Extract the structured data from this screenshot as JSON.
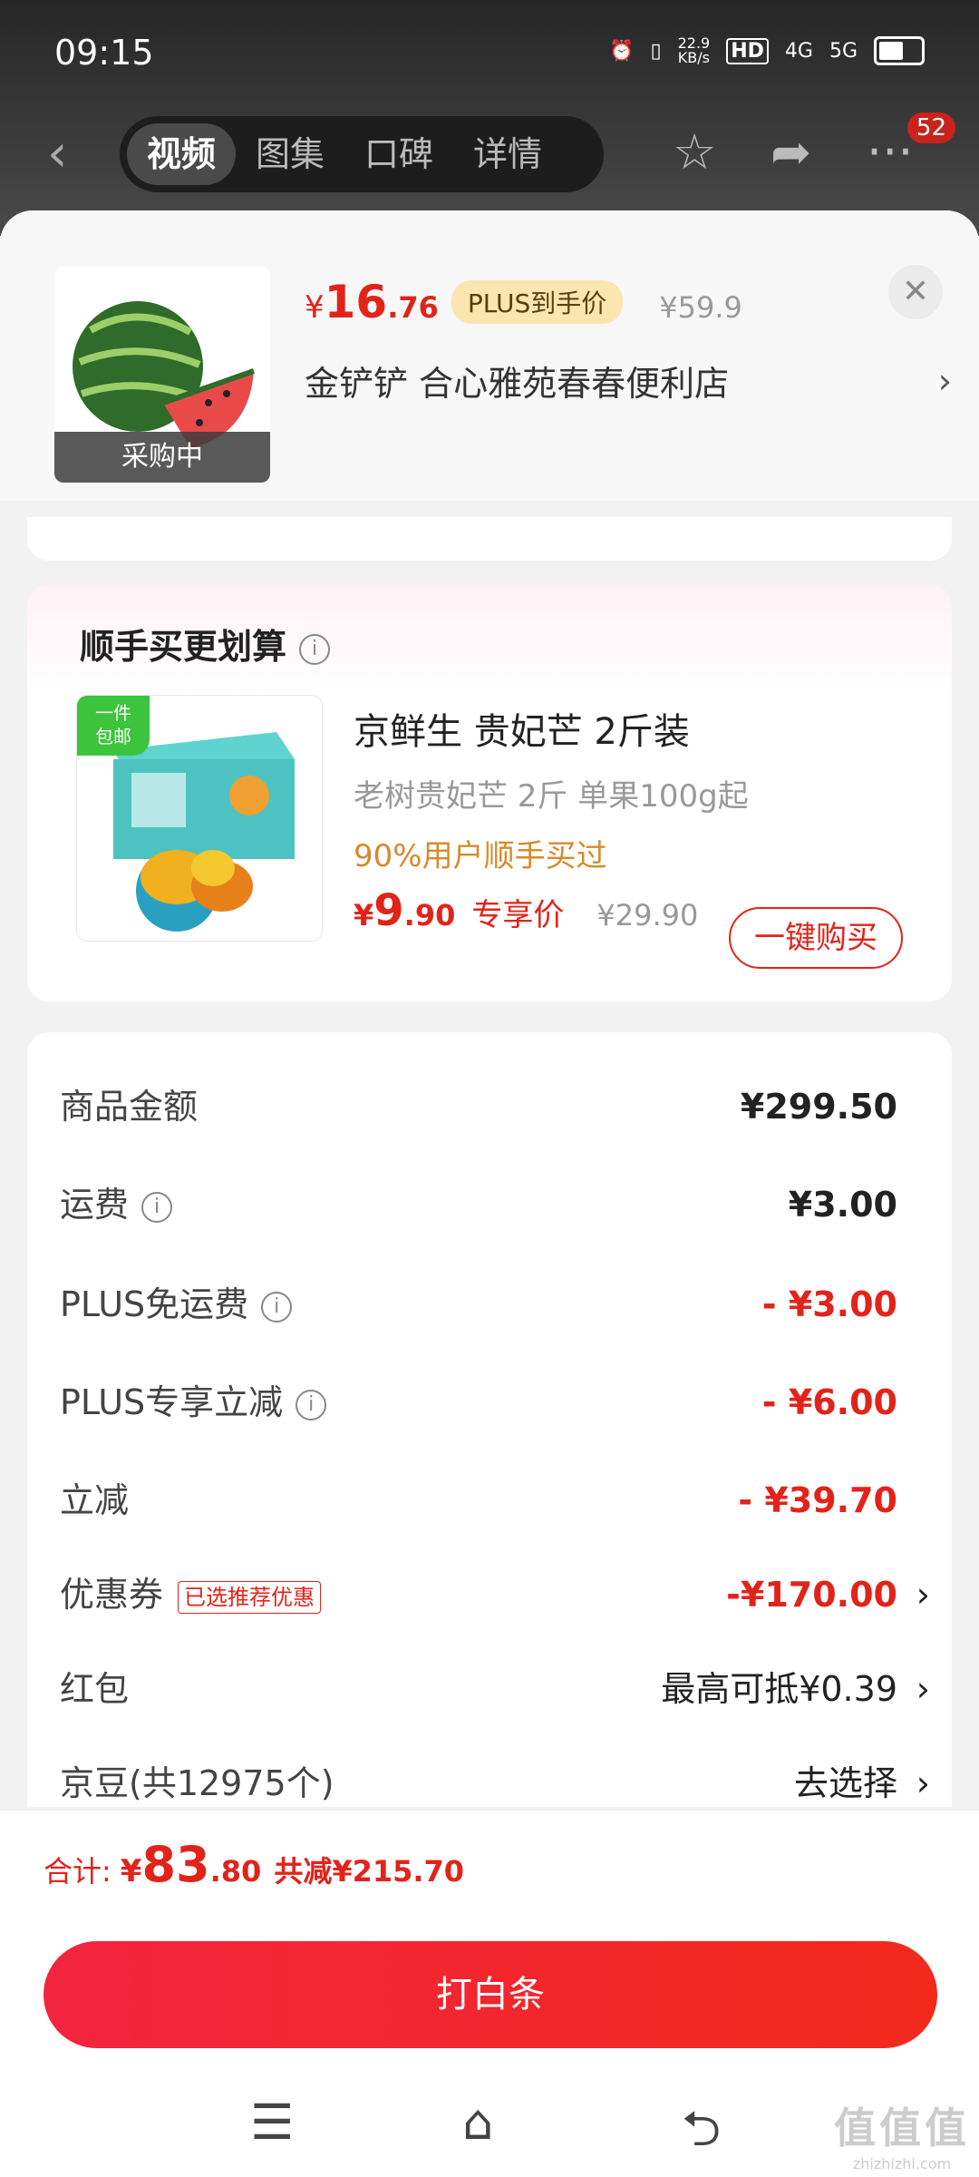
{
  "status_bar": {
    "time": "09:15",
    "speed_value": "22.9",
    "speed_unit": "KB/s",
    "hd": "HD",
    "net1": "4G",
    "net2": "5G"
  },
  "nav": {
    "tabs": [
      "视频",
      "图集",
      "口碑",
      "详情"
    ],
    "active_tab": "视频",
    "message_count": "52",
    "icons": [
      "back-icon",
      "star-icon",
      "share-icon",
      "more-icon"
    ]
  },
  "product": {
    "price_symbol": "¥",
    "price_int": "16",
    "price_dec": ".76",
    "plus_tag": "PLUS到手价",
    "original_price": "¥59.9",
    "store": "金铲铲  合心雅苑春春便利店",
    "thumb_label": "采购中"
  },
  "addon": {
    "title": "顺手买更划算",
    "free_tag_line1": "一件",
    "free_tag_line2": "包邮",
    "name": "京鲜生 贵妃芒 2斤装",
    "sub": "老树贵妃芒  2斤 单果100g起",
    "hint": "90%用户顺手买过",
    "price_symbol": "¥",
    "price_int": "9",
    "price_dec": ".90",
    "exclusive": "专享价",
    "original_price": "¥29.90",
    "buy_label": "一键购买"
  },
  "summary": {
    "rows": [
      {
        "label": "商品金额",
        "value": "¥299.50"
      },
      {
        "label": "运费",
        "value": "¥3.00"
      },
      {
        "label": "PLUS免运费",
        "value": "- ¥3.00"
      },
      {
        "label": "PLUS专享立减",
        "value": "- ¥6.00"
      },
      {
        "label": "立减",
        "value": "- ¥39.70"
      },
      {
        "label": "优惠券",
        "tag": "已选推荐优惠",
        "value": "-¥170.00"
      },
      {
        "label": "红包",
        "value": "最高可抵¥0.39"
      },
      {
        "label": "京豆(共12975个)",
        "value": "去选择"
      }
    ]
  },
  "footer": {
    "total_label": "合计:",
    "total_symbol": "¥",
    "total_int": "83",
    "total_dec": ".80",
    "saved": "共减¥215.70",
    "pay_label": "打白条"
  },
  "watermark": {
    "big": "值值值",
    "small": "zhizhizhi.com"
  },
  "colors": {
    "accent_red": "#e2231a",
    "plus_gold": "#fbe6b0",
    "hint_orange": "#d58b2a"
  }
}
